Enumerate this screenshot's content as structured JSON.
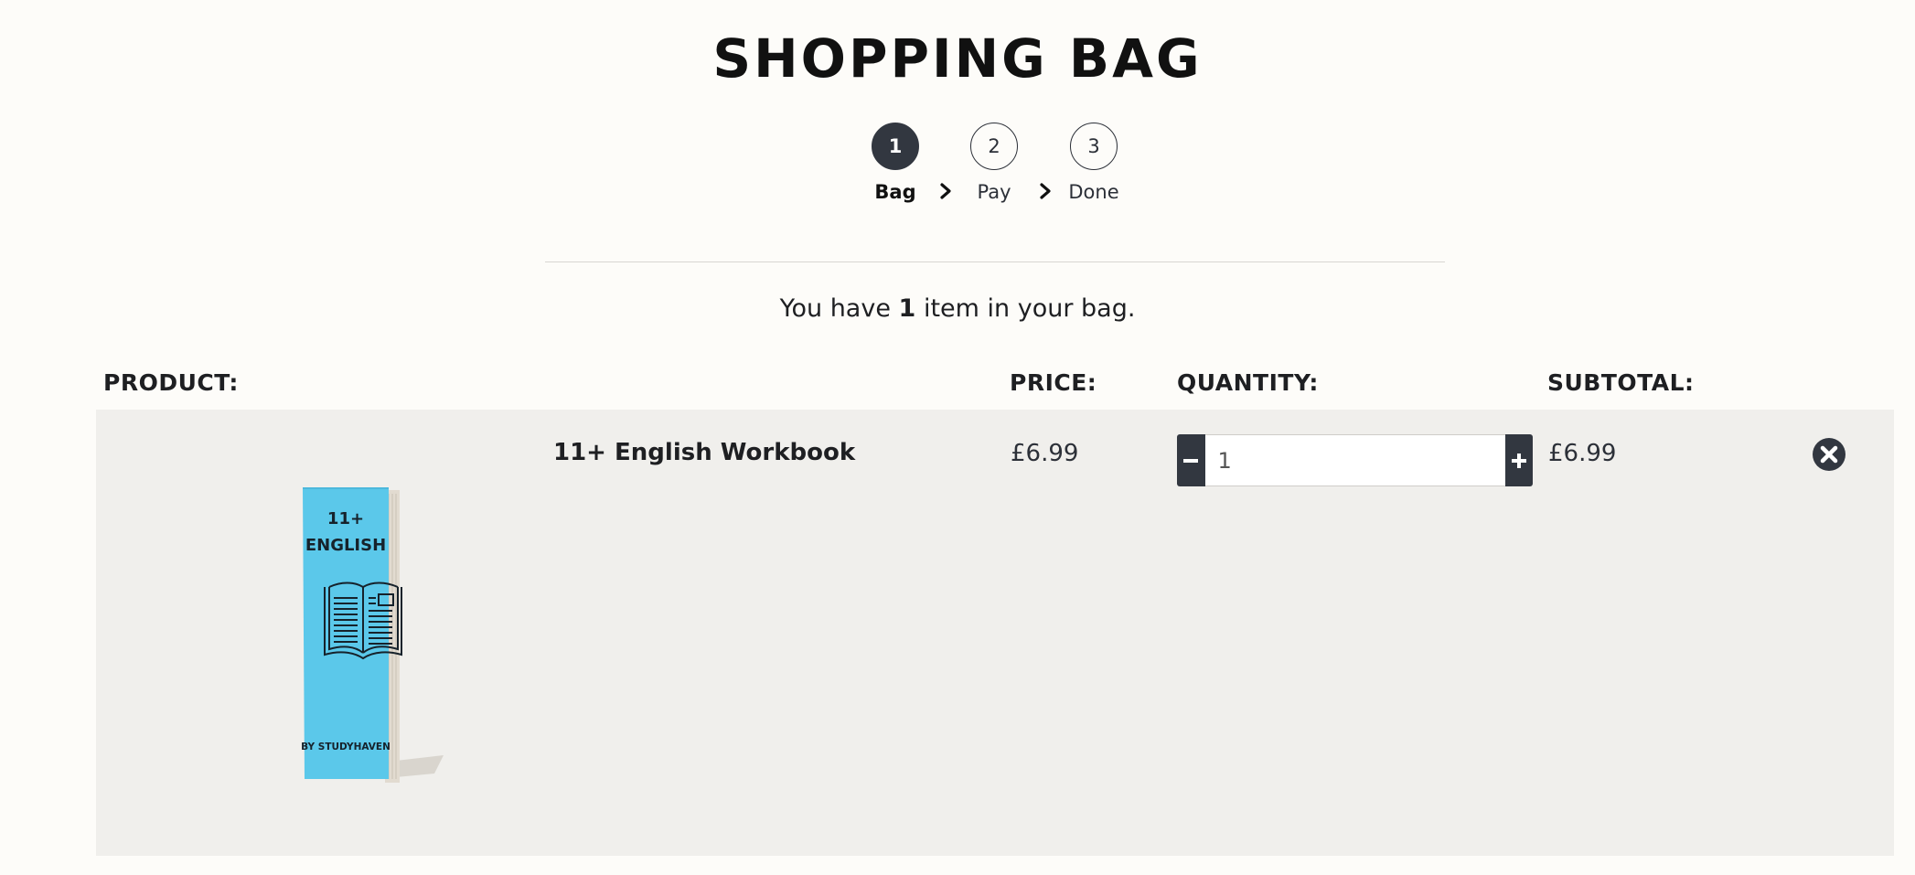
{
  "page": {
    "title": "SHOPPING BAG"
  },
  "steps": [
    {
      "number": "1",
      "label": "Bag",
      "active": true
    },
    {
      "number": "2",
      "label": "Pay",
      "active": false
    },
    {
      "number": "3",
      "label": "Done",
      "active": false
    }
  ],
  "bag_summary": {
    "prefix": "You have",
    "count": "1",
    "suffix": "item in your bag."
  },
  "columns": {
    "product": "PRODUCT:",
    "price": "PRICE:",
    "quantity": "QUANTITY:",
    "subtotal": "SUBTOTAL:"
  },
  "items": [
    {
      "name": "11+ English Workbook",
      "price": "£6.99",
      "quantity": "1",
      "subtotal": "£6.99",
      "cover": {
        "line1": "11+",
        "line2": "ENGLISH",
        "publisher": "BY STUDYHAVEN",
        "color": "#5bc8ea",
        "icon": "open-book-icon"
      }
    }
  ],
  "icons": {
    "chevron": "chevron-right-icon",
    "minus": "minus-icon",
    "plus": "plus-icon",
    "remove": "remove-circle-icon"
  },
  "colors": {
    "dark": "#323740",
    "background": "#fdfcf9",
    "row": "#f0efec",
    "cover": "#5bc8ea"
  }
}
